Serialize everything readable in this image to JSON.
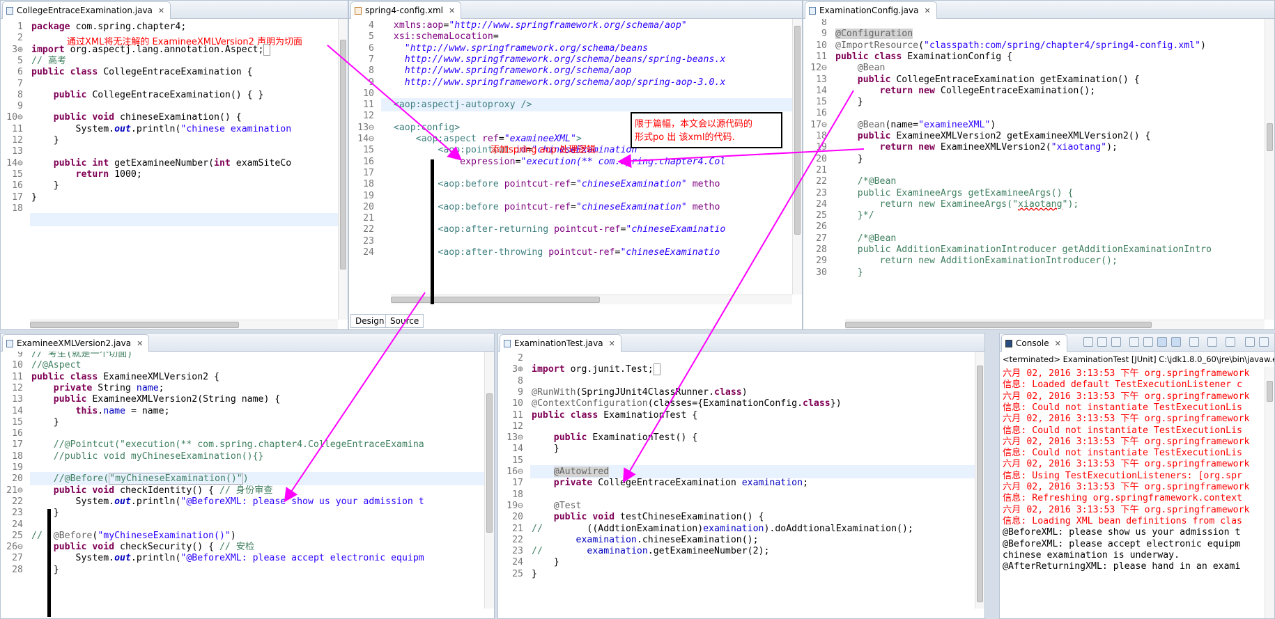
{
  "panes": {
    "college": {
      "tab": "CollegeEntraceExamination.java",
      "lines": [
        {
          "n": "1",
          "h": "<span class=\"kw\">package</span> com.spring.chapter4;"
        },
        {
          "n": "2",
          "h": ""
        },
        {
          "n": "3⊕",
          "h": "<span class=\"kw\">import</span> org.aspectj.lang.annotation.Aspect;<span style=\"border:1px solid #999\">&nbsp;</span>"
        },
        {
          "n": "5",
          "h": "<span class=\"cm\">// 高考</span>"
        },
        {
          "n": "6",
          "h": "<span class=\"kw\">public class</span> CollegeEntraceExamination {"
        },
        {
          "n": "7",
          "h": ""
        },
        {
          "n": "8",
          "h": "    <span class=\"kw\">public</span> CollegeEntraceExamination() { }"
        },
        {
          "n": "9",
          "h": ""
        },
        {
          "n": "10⊖",
          "h": "    <span class=\"kw\">public void</span> chineseExamination() {"
        },
        {
          "n": "11",
          "h": "        System.<span class=\"fld it\" style=\"font-weight:bold\">out</span>.println(<span class=\"str\">\"chinese examination</span>"
        },
        {
          "n": "12",
          "h": "    }"
        },
        {
          "n": "13",
          "h": ""
        },
        {
          "n": "14⊖",
          "h": "    <span class=\"kw\">public int</span> getExamineeNumber(<span class=\"kw\">int</span> examSiteCo"
        },
        {
          "n": "15",
          "h": "        <span class=\"kw\">return</span> 1000;"
        },
        {
          "n": "16",
          "h": "    }"
        },
        {
          "n": "17",
          "h": "}"
        },
        {
          "n": "18",
          "h": ""
        }
      ],
      "note": "通过XML将无注解的 ExamineeXMLVersion2 声明为切面"
    },
    "springxml": {
      "tab": "spring4-config.xml",
      "lines": [
        {
          "n": "4",
          "h": "  <span class=\"xattr\">xmlns:aop</span>=<span class=\"xval\">\"http://www.springframework.org/schema/aop\"</span>"
        },
        {
          "n": "5",
          "h": "  <span class=\"xattr\">xsi:schemaLocation</span>="
        },
        {
          "n": "6",
          "h": "    <span class=\"xval\">\"http://www.springframework.org/schema/beans</span>"
        },
        {
          "n": "7",
          "h": "    <span class=\"xval\">http://www.springframework.org/schema/beans/spring-beans.x</span>"
        },
        {
          "n": "8",
          "h": "    <span class=\"xval\">http://www.springframework.org/schema/aop</span>"
        },
        {
          "n": "9",
          "h": "    <span class=\"xval\">http://www.springframework.org/schema/aop/spring-aop-3.0.x</span>"
        },
        {
          "n": "10",
          "h": ""
        },
        {
          "n": "11",
          "h": "  <span class=\"xtag\">&lt;aop:aspectj-autoproxy /&gt;</span>"
        },
        {
          "n": "12",
          "h": ""
        },
        {
          "n": "13⊖",
          "h": "  <span class=\"xtag\">&lt;aop:config&gt;</span>"
        },
        {
          "n": "14⊖",
          "h": "      <span class=\"xtag\">&lt;aop:aspect</span> <span class=\"xattr\">ref</span>=<span class=\"xval\">\"examineeXML\"</span><span class=\"xtag\">&gt;</span>"
        },
        {
          "n": "15",
          "h": "          <span class=\"xtag\">&lt;aop:pointcut</span> <span class=\"xattr\">id</span>=<span class=\"xval\">\"chineseExamination\"</span>"
        },
        {
          "n": "16",
          "h": "              <span class=\"xattr\">expression</span>=<span class=\"xval\">\"execution(** com.spring.chapter4.Col</span>"
        },
        {
          "n": "17",
          "h": ""
        },
        {
          "n": "18",
          "h": "          <span class=\"xtag\">&lt;aop:before</span> <span class=\"xattr\">pointcut-ref</span>=<span class=\"xval\">\"chineseExamination\"</span> <span class=\"xattr\">metho</span>"
        },
        {
          "n": "19",
          "h": ""
        },
        {
          "n": "20",
          "h": "          <span class=\"xtag\">&lt;aop:before</span> <span class=\"xattr\">pointcut-ref</span>=<span class=\"xval\">\"chineseExamination\"</span> <span class=\"xattr\">metho</span>"
        },
        {
          "n": "21",
          "h": ""
        },
        {
          "n": "22",
          "h": "          <span class=\"xtag\">&lt;aop:after-returning</span> <span class=\"xattr\">pointcut-ref</span>=<span class=\"xval\">\"chineseExaminatio</span>"
        },
        {
          "n": "23",
          "h": ""
        },
        {
          "n": "24",
          "h": "          <span class=\"xtag\">&lt;aop:after-throwing</span> <span class=\"xattr\">pointcut-ref</span>=<span class=\"xval\">\"chineseExaminatio</span>"
        }
      ],
      "note_box": "限于篇幅，本文会以源代码的\n形式po 出 该xml的代码.",
      "note_aop": "添加spring aop 处理逻辑.",
      "bottom_tabs": [
        "Design",
        "Source"
      ]
    },
    "config": {
      "tab": "ExaminationConfig.java",
      "lines": [
        {
          "n": "8",
          "h": ""
        },
        {
          "n": "9",
          "h": "<span class=\"an\" style=\"background:#d4d4d4\">@Configuration</span>"
        },
        {
          "n": "10",
          "h": "<span class=\"an\">@ImportResource</span>(<span class=\"str\">\"classpath:com/spring/chapter4/spring4-config.xml\"</span>)"
        },
        {
          "n": "11",
          "h": "<span class=\"kw\">public class</span> ExaminationConfig {"
        },
        {
          "n": "12⊖",
          "h": "    <span class=\"an\">@Bean</span>"
        },
        {
          "n": "13",
          "h": "    <span class=\"kw\">public</span> CollegeEntraceExamination getExamination() {"
        },
        {
          "n": "14",
          "h": "        <span class=\"kw\">return new</span> CollegeEntraceExamination();"
        },
        {
          "n": "15",
          "h": "    }"
        },
        {
          "n": "16",
          "h": ""
        },
        {
          "n": "17⊖",
          "h": "    <span class=\"an\">@Bean</span>(name=<span class=\"str\">\"examineeXML\"</span>)"
        },
        {
          "n": "18",
          "h": "    <span class=\"kw\">public</span> ExamineeXMLVersion2 getExamineeXMLVersion2() {"
        },
        {
          "n": "19",
          "h": "        <span class=\"kw\">return new</span> ExamineeXMLVersion2(<span class=\"str\">\"xiaotang\"</span>);"
        },
        {
          "n": "20",
          "h": "    }"
        },
        {
          "n": "21",
          "h": ""
        },
        {
          "n": "22",
          "h": "    <span class=\"cm\">/*@Bean</span>"
        },
        {
          "n": "23",
          "h": "<span class=\"cm\">    public ExamineeArgs getExamineeArgs() {</span>"
        },
        {
          "n": "24",
          "h": "<span class=\"cm\">        return new ExamineeArgs(\"<u style=\"text-decoration-color:#e00;text-decoration-style:wavy\">xiaotang</u>\");</span>"
        },
        {
          "n": "25",
          "h": "<span class=\"cm\">    }*/</span>"
        },
        {
          "n": "26",
          "h": ""
        },
        {
          "n": "27",
          "h": "    <span class=\"cm\">/*@Bean</span>"
        },
        {
          "n": "28",
          "h": "<span class=\"cm\">    public AdditionExaminationIntroducer getAdditionExaminationIntro</span>"
        },
        {
          "n": "29",
          "h": "<span class=\"cm\">        return new AdditionExaminationIntroducer();</span>"
        },
        {
          "n": "30",
          "h": "<span class=\"cm\">    }</span>"
        }
      ]
    },
    "examinee": {
      "tab": "ExamineeXMLVersion2.java",
      "lines": [
        {
          "n": "9",
          "h": "<span class=\"cm\">// 考生(就是一个切面)</span>"
        },
        {
          "n": "10",
          "h": "<span class=\"cm\">//@Aspect</span>"
        },
        {
          "n": "11",
          "h": "<span class=\"kw\">public class</span> ExamineeXMLVersion2 {"
        },
        {
          "n": "12",
          "h": "    <span class=\"kw\">private</span> String <span class=\"fld\">name</span>;"
        },
        {
          "n": "13",
          "h": "    <span class=\"kw\">public</span> ExamineeXMLVersion2(String name) {"
        },
        {
          "n": "14",
          "h": "        <span class=\"kw\">this</span>.<span class=\"fld\">name</span> = name;"
        },
        {
          "n": "15",
          "h": "    }"
        },
        {
          "n": "16",
          "h": ""
        },
        {
          "n": "17",
          "h": "    <span class=\"cm\">//@Pointcut(\"execution(** com.spring.chapter4.CollegeEntraceExamina</span>"
        },
        {
          "n": "18",
          "h": "    <span class=\"cm\">//public void myChineseExamination(){}</span>"
        },
        {
          "n": "19",
          "h": ""
        },
        {
          "n": "20",
          "h": "    <span class=\"cm\">//@Before(</span><span class=\"cm\" style=\"border:1px solid #aaa\">\"myChineseExamination()\"</span><span class=\"cm\">)</span>"
        },
        {
          "n": "21⊖",
          "h": "    <span class=\"kw\">public void</span> checkIdentity() { <span class=\"cm\">// 身份审查</span>"
        },
        {
          "n": "22",
          "h": "        System.<span class=\"fld it\" style=\"font-weight:bold\">out</span>.println(<span class=\"str\">\"@BeforeXML: please show us your admission t</span>"
        },
        {
          "n": "23",
          "h": "    }"
        },
        {
          "n": "24",
          "h": ""
        },
        {
          "n": "25",
          "h": "<span class=\"cm\">//</span>  <span class=\"an\">@Before</span>(<span class=\"str\">\"myChineseExamination()\"</span>)"
        },
        {
          "n": "26⊖",
          "h": "    <span class=\"kw\">public void</span> checkSecurity() { <span class=\"cm\">// 安检</span>"
        },
        {
          "n": "27",
          "h": "        System.<span class=\"fld it\" style=\"font-weight:bold\">out</span>.println(<span class=\"str\">\"@BeforeXML: please accept electronic equipm</span>"
        },
        {
          "n": "28",
          "h": "    }"
        }
      ]
    },
    "test": {
      "tab": "ExaminationTest.java",
      "lines": [
        {
          "n": "2",
          "h": ""
        },
        {
          "n": "3⊕",
          "h": "<span class=\"kw\">import</span> org.junit.Test;<span style=\"border:1px solid #999\">&nbsp;</span>"
        },
        {
          "n": "8",
          "h": ""
        },
        {
          "n": "9",
          "h": "<span class=\"an\">@RunWith</span>(SpringJUnit4ClassRunner.<span class=\"kw\">class</span>)"
        },
        {
          "n": "10",
          "h": "<span class=\"an\">@ContextConfiguration</span>(classes={ExaminationConfig.<span class=\"kw\">class</span>})"
        },
        {
          "n": "11",
          "h": "<span class=\"kw\">public class</span> ExaminationTest {"
        },
        {
          "n": "12",
          "h": ""
        },
        {
          "n": "13⊖",
          "h": "    <span class=\"kw\">public</span> ExaminationTest() {"
        },
        {
          "n": "14",
          "h": "    }"
        },
        {
          "n": "15",
          "h": ""
        },
        {
          "n": "16⊖",
          "h": "    <span class=\"an\" style=\"background:#d4d4d4\">@Autowired</span>"
        },
        {
          "n": "17",
          "h": "    <span class=\"kw\">private</span> CollegeEntraceExamination <span class=\"fld\">examination</span>;"
        },
        {
          "n": "18",
          "h": ""
        },
        {
          "n": "19⊖",
          "h": "    <span class=\"an\">@Test</span>"
        },
        {
          "n": "20",
          "h": "    <span class=\"kw\">public void</span> testChineseExamination() {"
        },
        {
          "n": "21",
          "h": "<span class=\"cm\">//</span>        ((AddtionExamination)<span class=\"fld\">examination</span>).doAddtionalExamination();"
        },
        {
          "n": "22",
          "h": "        <span class=\"fld\">examination</span>.chineseExamination();"
        },
        {
          "n": "23",
          "h": "<span class=\"cm\">//</span>        <span class=\"fld\">examination</span>.getExamineeNumber(2);"
        },
        {
          "n": "24",
          "h": "    }"
        },
        {
          "n": "25",
          "h": "}"
        }
      ]
    },
    "console": {
      "tab": "Console",
      "status": "<terminated> ExaminationTest [JUnit] C:\\jdk1.8.0_60\\jre\\bin\\javaw.e",
      "lines": [
        {
          "c": "red",
          "t": "六月 02, 2016 3:13:53 下午 org.springframework"
        },
        {
          "c": "red",
          "t": "信息: Loaded default TestExecutionListener c"
        },
        {
          "c": "red",
          "t": "六月 02, 2016 3:13:53 下午 org.springframework"
        },
        {
          "c": "red",
          "t": "信息: Could not instantiate TestExecutionLis"
        },
        {
          "c": "red",
          "t": "六月 02, 2016 3:13:53 下午 org.springframework"
        },
        {
          "c": "red",
          "t": "信息: Could not instantiate TestExecutionLis"
        },
        {
          "c": "red",
          "t": "六月 02, 2016 3:13:53 下午 org.springframework"
        },
        {
          "c": "red",
          "t": "信息: Could not instantiate TestExecutionLis"
        },
        {
          "c": "red",
          "t": "六月 02, 2016 3:13:53 下午 org.springframework"
        },
        {
          "c": "red",
          "t": "信息: Using TestExecutionListeners: [org.spr"
        },
        {
          "c": "red",
          "t": "六月 02, 2016 3:13:53 下午 org.springframework"
        },
        {
          "c": "red",
          "t": "信息: Refreshing org.springframework.context"
        },
        {
          "c": "red",
          "t": "六月 02, 2016 3:13:53 下午 org.springframework"
        },
        {
          "c": "red",
          "t": "信息: Loading XML bean definitions from clas"
        },
        {
          "c": "blk",
          "t": "@BeforeXML: please show us your admission t"
        },
        {
          "c": "blk",
          "t": "@BeforeXML: please accept electronic equipm"
        },
        {
          "c": "blk",
          "t": "chinese examination is underway."
        },
        {
          "c": "blk",
          "t": "@AfterReturningXML: please hand in an exami"
        }
      ]
    }
  }
}
